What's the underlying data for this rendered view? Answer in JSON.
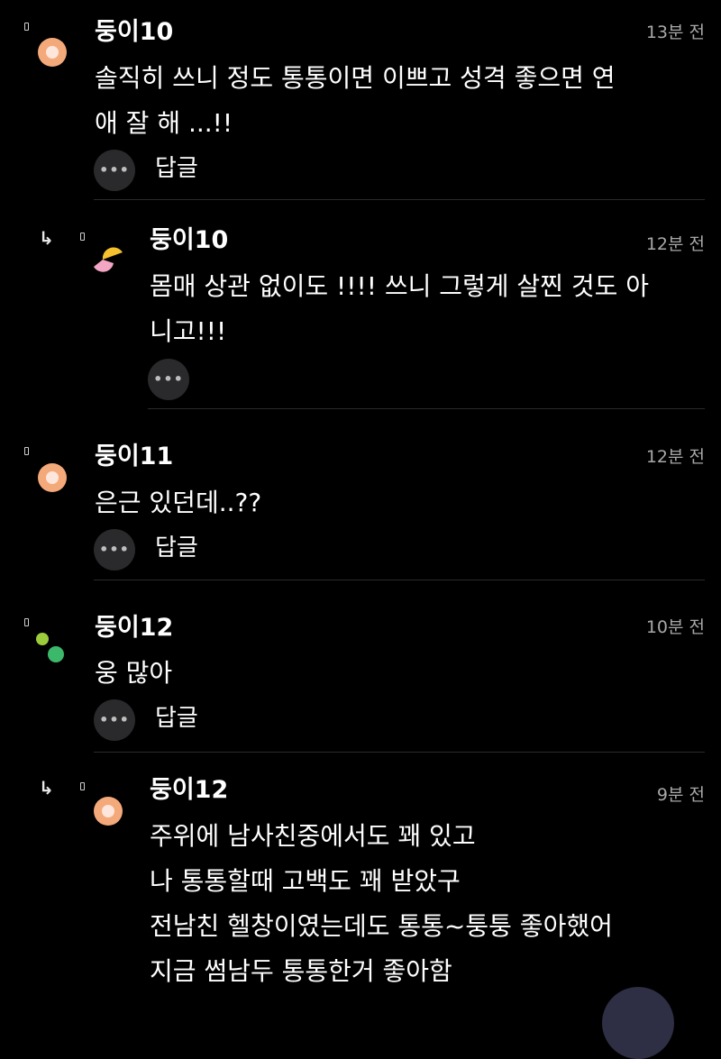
{
  "comments": [
    {
      "nickname": "둥이10",
      "time": "13분 전",
      "lines": [
        "솔직히 쓰니 정도 통통이면 이쁘고 성격 좋으면 연",
        "애 잘 해 ...!!"
      ],
      "reply_label": "답글",
      "more_label": "•••",
      "avatar": "orange-circle-avatar"
    },
    {
      "nickname": "둥이10",
      "time": "12분 전",
      "lines": [
        "몸매 상관 없이도 !!!! 쓰니 그렇게 살찐 것도 아",
        "니고!!!"
      ],
      "more_label": "•••",
      "avatar": "yellow-pink-avatar",
      "is_reply": true
    },
    {
      "nickname": "둥이11",
      "time": "12분 전",
      "lines": [
        "은근 있던데..??"
      ],
      "reply_label": "답글",
      "more_label": "•••",
      "avatar": "orange-circle-avatar"
    },
    {
      "nickname": "둥이12",
      "time": "10분 전",
      "lines": [
        "웅 많아"
      ],
      "reply_label": "답글",
      "more_label": "•••",
      "avatar": "green-dots-avatar"
    },
    {
      "nickname": "둥이12",
      "time": "9분 전",
      "lines": [
        "주위에 남사친중에서도 꽤 있고",
        "나 통통할때 고백도 꽤 받았구",
        "전남친 헬창이였는데도 통통~퉁퉁 좋아했어",
        "지금 썸남두 통통한거 좋아함"
      ],
      "avatar": "orange-circle-avatar",
      "is_reply": true
    }
  ],
  "reply_arrow_icon": "reply-arrow-icon",
  "colors": {
    "background": "#000000",
    "avatar_orange": "#f4a97a",
    "avatar_yellow": "#f5c12e",
    "avatar_pink": "#f2a6c4",
    "avatar_green_light": "#9ccc3c",
    "avatar_green": "#3cb86a"
  }
}
